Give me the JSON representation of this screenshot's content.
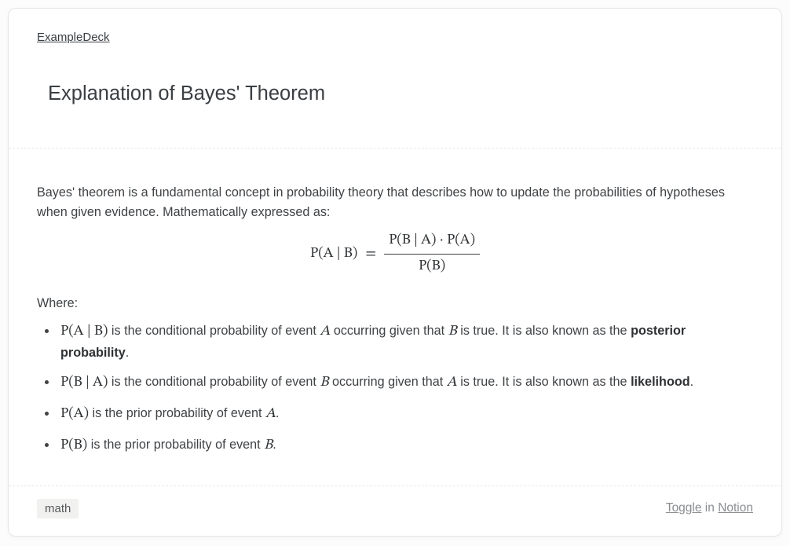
{
  "deck_link": "ExampleDeck",
  "title": "Explanation of Bayes' Theorem",
  "intro": "Bayes' theorem is a fundamental concept in probability theory that describes how to update the probabilities of hypotheses when given evidence. Mathematically expressed as:",
  "equation": {
    "lhs": "P(A | B)",
    "eq": "=",
    "num": "P(B | A) · P(A)",
    "den": "P(B)"
  },
  "where_label": "Where:",
  "defs": [
    {
      "sym": "P(A | B)",
      "text_a": " is the conditional probability of event ",
      "var1": "A",
      "text_b": " occurring given that ",
      "var2": "B",
      "text_c": " is true. It is also known as the ",
      "bold": "posterior probability",
      "text_d": "."
    },
    {
      "sym": "P(B | A)",
      "text_a": " is the conditional probability of event ",
      "var1": "B",
      "text_b": " occurring given that ",
      "var2": "A",
      "text_c": " is true. It is also known as the ",
      "bold": "likelihood",
      "text_d": "."
    },
    {
      "sym": "P(A)",
      "text_a": " is the prior probability of event ",
      "var1": "A",
      "text_b": "",
      "var2": "",
      "text_c": "",
      "bold": "",
      "text_d": "."
    },
    {
      "sym": "P(B)",
      "text_a": " is the prior probability of event ",
      "var1": "B",
      "text_b": "",
      "var2": "",
      "text_c": "",
      "bold": "",
      "text_d": "."
    }
  ],
  "tag": "math",
  "footer": {
    "toggle": "Toggle",
    "in": " in ",
    "notion": "Notion"
  }
}
